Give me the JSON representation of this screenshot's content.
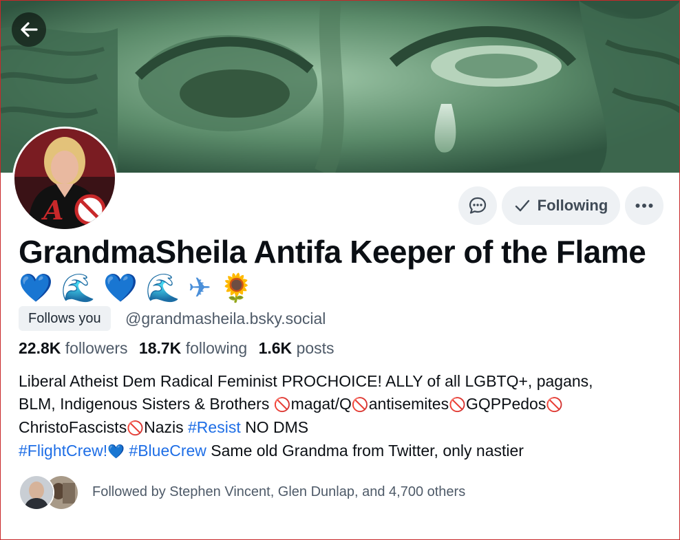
{
  "header": {
    "back_icon": "arrow-left-icon"
  },
  "profile": {
    "display_name": "GrandmaSheila Antifa Keeper of the Flame",
    "display_name_emojis": [
      "💙",
      "🌊",
      "💙",
      "🌊",
      "✈",
      "🌻"
    ],
    "follows_you_label": "Follows you",
    "handle": "@grandmasheila.bsky.social"
  },
  "actions": {
    "message_icon": "chat-bubble-icon",
    "following_icon": "checkmark-icon",
    "following_label": "Following",
    "more_icon": "ellipsis-icon"
  },
  "stats": {
    "followers_count": "22.8K",
    "followers_label": "followers",
    "following_count": "18.7K",
    "following_label": "following",
    "posts_count": "1.6K",
    "posts_label": "posts"
  },
  "bio": {
    "line1": "Liberal Atheist Dem Radical Feminist PROCHOICE! ALLY of all LGBTQ+, pagans,",
    "line2_text": "BLM, Indigenous Sisters & Brothers ",
    "no_symbol": "🚫",
    "line2_a": "magat/Q",
    "line2_b": "antisemites",
    "line2_c": "GQPPedos",
    "line3_a": "ChristoFascists",
    "line3_b": "Nazis ",
    "tag_resist": "#Resist",
    "line3_c": " NO DMS",
    "tag_flightcrew": "#FlightCrew!",
    "heart": "💙",
    "tag_bluecrew": "#BlueCrew",
    "line4_rest": " Same old Grandma from Twitter, only nastier"
  },
  "followed_by": {
    "text": "Followed by Stephen Vincent, Glen Dunlap, and 4,700 others"
  },
  "colors": {
    "accent": "#1e6ee6",
    "button_bg": "#eef1f4",
    "muted_text": "#4e5a68",
    "frame_border": "#c8282a"
  }
}
